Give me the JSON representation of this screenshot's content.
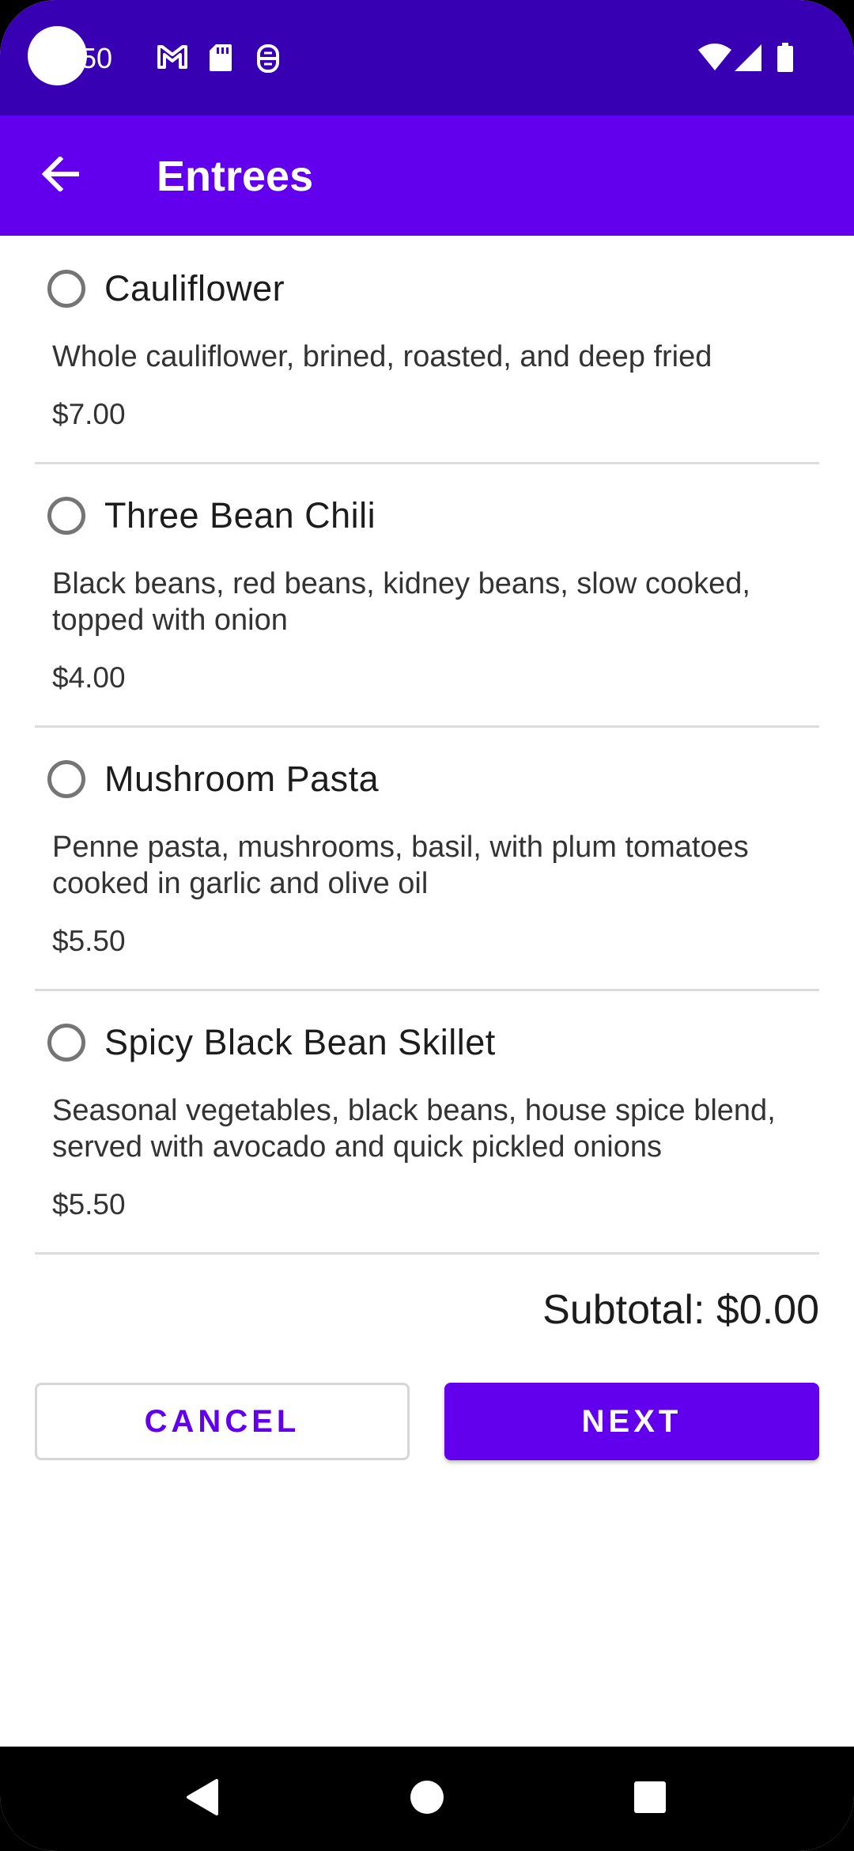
{
  "status_bar": {
    "time": ":50",
    "icons": [
      "gmail-icon",
      "sd-card-icon",
      "accessibility-icon",
      "wifi-icon",
      "signal-icon",
      "battery-icon"
    ]
  },
  "app_bar": {
    "title": "Entrees",
    "back_icon": "arrow-back-icon"
  },
  "menu": {
    "items": [
      {
        "name": "Cauliflower",
        "description": "Whole cauliflower, brined, roasted, and deep fried",
        "price": "$7.00",
        "selected": false
      },
      {
        "name": "Three Bean Chili",
        "description": "Black beans, red beans, kidney beans, slow cooked, topped with onion",
        "price": "$4.00",
        "selected": false
      },
      {
        "name": "Mushroom Pasta",
        "description": "Penne pasta, mushrooms, basil, with plum tomatoes cooked in garlic and olive oil",
        "price": "$5.50",
        "selected": false
      },
      {
        "name": "Spicy Black Bean Skillet",
        "description": "Seasonal vegetables, black beans, house spice blend, served with avocado and quick pickled onions",
        "price": "$5.50",
        "selected": false
      }
    ]
  },
  "subtotal": "Subtotal: $0.00",
  "buttons": {
    "cancel_label": "CANCEL",
    "next_label": "NEXT"
  },
  "nav_bar": {
    "icons": [
      "back-triangle-icon",
      "home-circle-icon",
      "recents-square-icon"
    ]
  },
  "colors": {
    "status_bar": "#3700B3",
    "primary": "#6200EE",
    "divider": "#DCDCDC"
  }
}
